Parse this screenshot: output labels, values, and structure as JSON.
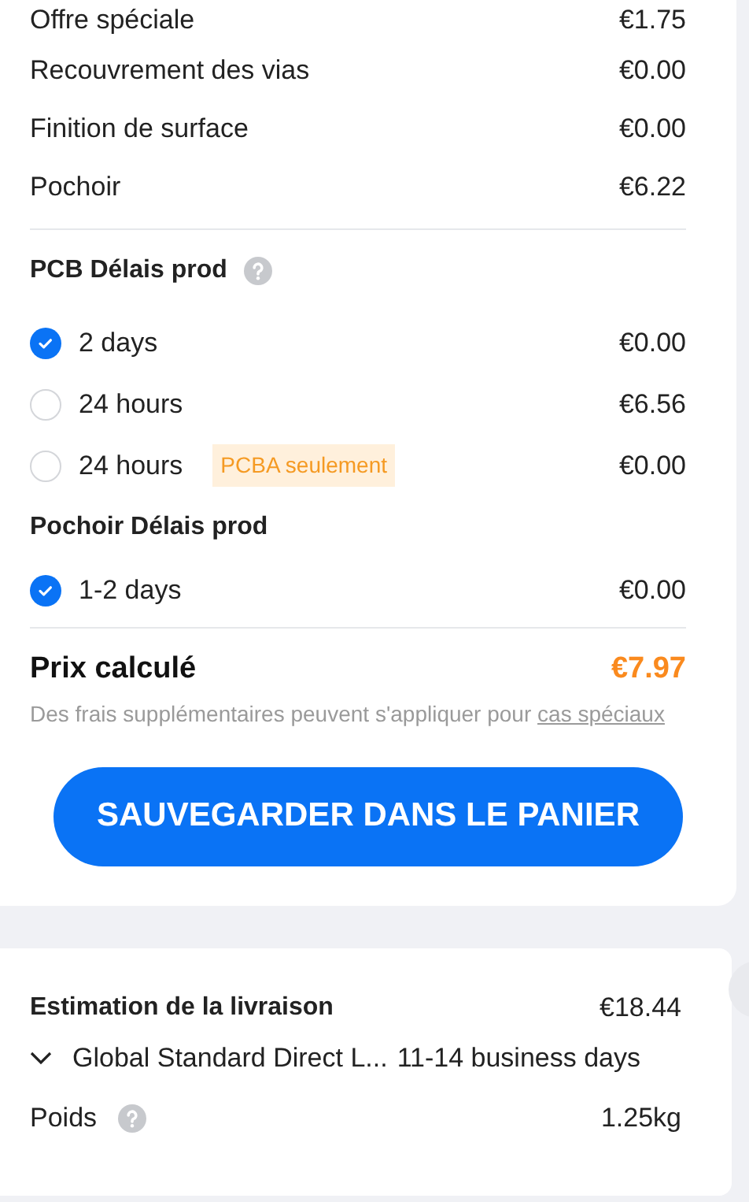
{
  "fees": [
    {
      "label": "Offre spéciale",
      "price": "€1.75"
    },
    {
      "label": "Recouvrement des vias",
      "price": "€0.00"
    },
    {
      "label": "Finition de surface",
      "price": "€0.00"
    },
    {
      "label": "Pochoir",
      "price": "€6.22"
    }
  ],
  "pcb_lead": {
    "title": "PCB Délais prod",
    "options": [
      {
        "label": "2 days",
        "price": "€0.00",
        "selected": true
      },
      {
        "label": "24 hours",
        "price": "€6.56",
        "selected": false
      },
      {
        "label": "24 hours",
        "badge": "PCBA seulement",
        "price": "€0.00",
        "selected": false
      }
    ]
  },
  "stencil_lead": {
    "title": "Pochoir Délais prod",
    "options": [
      {
        "label": "1-2 days",
        "price": "€0.00",
        "selected": true
      }
    ]
  },
  "total": {
    "label": "Prix calculé",
    "price": "€7.97",
    "note": "Des frais supplémentaires peuvent s'appliquer pour",
    "link": "cas spéciaux"
  },
  "save_button": "SAUVEGARDER DANS LE PANIER",
  "shipping": {
    "label": "Estimation de la livraison",
    "price": "€18.44",
    "method": "Global Standard Direct L...",
    "duration": "11-14 business days",
    "weight_label": "Poids",
    "weight": "1.25kg"
  }
}
